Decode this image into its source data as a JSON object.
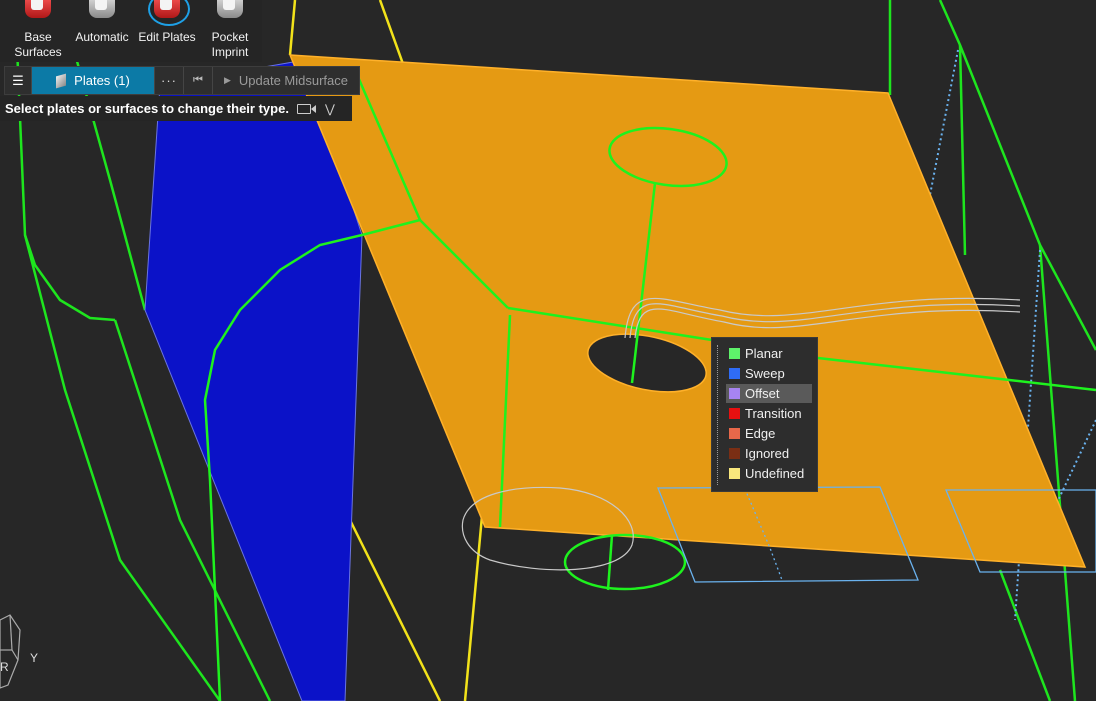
{
  "ribbon": {
    "tools": [
      {
        "label": "Base Surfaces",
        "icon": "base-surfaces-icon",
        "active": false
      },
      {
        "label": "Automatic",
        "icon": "automatic-icon",
        "active": false
      },
      {
        "label": "Edit Plates",
        "icon": "edit-plates-icon",
        "active": true
      },
      {
        "label": "Pocket Imprint",
        "icon": "pocket-imprint-icon",
        "active": false
      }
    ]
  },
  "toolbar": {
    "menu_icon": "hamburger-menu-icon",
    "selector_label": "Plates (1)",
    "more_label": "···",
    "update_label": "Update Midsurface"
  },
  "hint": {
    "text": "Select plates or surfaces to change their type."
  },
  "plate_types": {
    "items": [
      {
        "label": "Planar",
        "color": "#5ef26a"
      },
      {
        "label": "Sweep",
        "color": "#2f6cf5"
      },
      {
        "label": "Offset",
        "color": "#a784f2",
        "highlighted": true
      },
      {
        "label": "Transition",
        "color": "#e81010"
      },
      {
        "label": "Edge",
        "color": "#e8684a"
      },
      {
        "label": "Ignored",
        "color": "#7a2e14"
      },
      {
        "label": "Undefined",
        "color": "#f8e77c"
      }
    ]
  },
  "colors": {
    "plate": "#e59a13",
    "sweep_plate": "#0b12c8",
    "edge": "#1ef21e",
    "yellow_edge": "#f2e21a",
    "accent": "#0c7aa6"
  },
  "gizmo": {
    "label_y": "Y",
    "label_r": "R"
  }
}
